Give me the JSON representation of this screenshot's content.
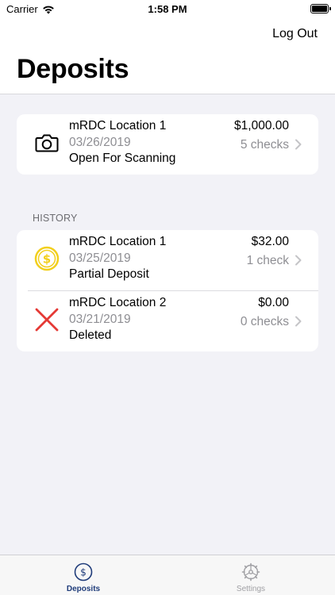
{
  "status_bar": {
    "carrier": "Carrier",
    "time": "1:58 PM"
  },
  "header": {
    "logout_label": "Log Out",
    "title": "Deposits"
  },
  "open_deposit": {
    "name": "mRDC Location 1",
    "date": "03/26/2019",
    "status": "Open For Scanning",
    "amount": "$1,000.00",
    "checks": "5 checks",
    "icon": "camera-icon"
  },
  "history": {
    "label": "HISTORY",
    "items": [
      {
        "name": "mRDC Location 1",
        "date": "03/25/2019",
        "status": "Partial Deposit",
        "amount": "$32.00",
        "checks": "1 check",
        "icon": "dollar-coin-icon"
      },
      {
        "name": "mRDC Location 2",
        "date": "03/21/2019",
        "status": "Deleted",
        "amount": "$0.00",
        "checks": "0 checks",
        "icon": "x-mark-icon"
      }
    ]
  },
  "tabbar": {
    "deposits_label": "Deposits",
    "settings_label": "Settings",
    "active": "Deposits"
  },
  "colors": {
    "accent": "#1f3c7a",
    "coin": "#f2cf1d",
    "delete": "#e53935",
    "secondary_text": "#8e8e93",
    "background": "#f2f2f7"
  }
}
